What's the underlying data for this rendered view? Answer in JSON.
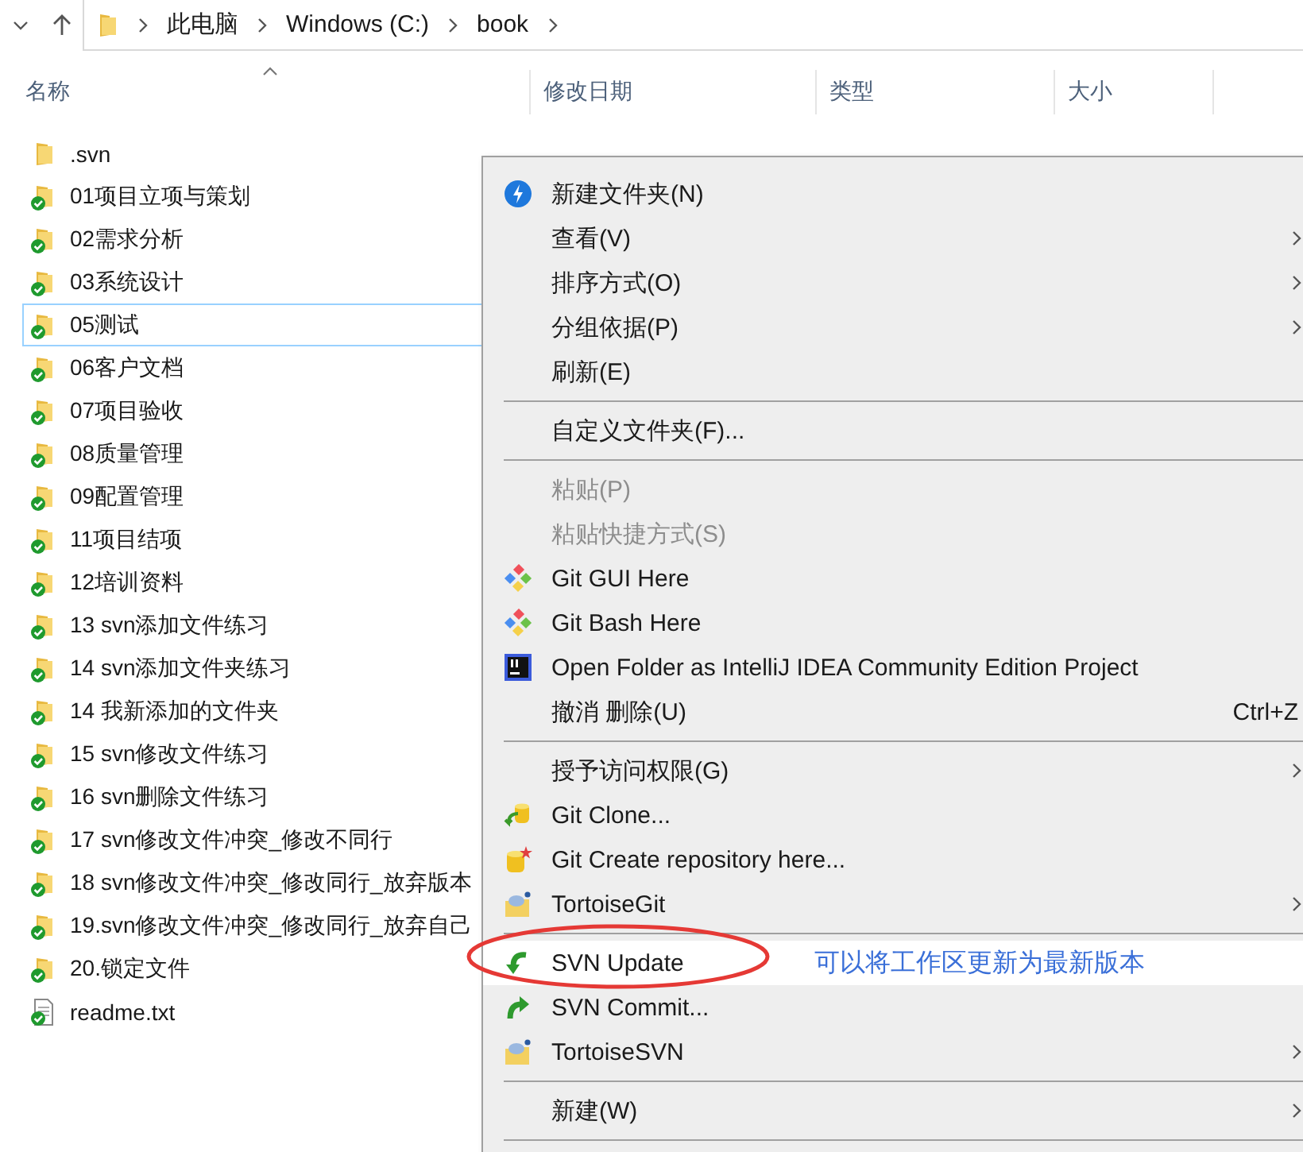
{
  "address_bar": {
    "breadcrumbs": [
      "此电脑",
      "Windows (C:)",
      "book"
    ]
  },
  "columns": [
    {
      "label": "名称",
      "sorted": true
    },
    {
      "label": "修改日期",
      "sorted": false
    },
    {
      "label": "类型",
      "sorted": false
    },
    {
      "label": "大小",
      "sorted": false
    }
  ],
  "files": [
    {
      "name": ".svn",
      "kind": "folder",
      "versioned": false,
      "focused": false
    },
    {
      "name": "01项目立项与策划",
      "kind": "folder",
      "versioned": true,
      "focused": false
    },
    {
      "name": "02需求分析",
      "kind": "folder",
      "versioned": true,
      "focused": false
    },
    {
      "name": "03系统设计",
      "kind": "folder",
      "versioned": true,
      "focused": false
    },
    {
      "name": "05测试",
      "kind": "folder",
      "versioned": true,
      "focused": true
    },
    {
      "name": "06客户文档",
      "kind": "folder",
      "versioned": true,
      "focused": false
    },
    {
      "name": "07项目验收",
      "kind": "folder",
      "versioned": true,
      "focused": false
    },
    {
      "name": "08质量管理",
      "kind": "folder",
      "versioned": true,
      "focused": false
    },
    {
      "name": "09配置管理",
      "kind": "folder",
      "versioned": true,
      "focused": false
    },
    {
      "name": "11项目结项",
      "kind": "folder",
      "versioned": true,
      "focused": false
    },
    {
      "name": "12培训资料",
      "kind": "folder",
      "versioned": true,
      "focused": false
    },
    {
      "name": "13 svn添加文件练习",
      "kind": "folder",
      "versioned": true,
      "focused": false
    },
    {
      "name": "14 svn添加文件夹练习",
      "kind": "folder",
      "versioned": true,
      "focused": false
    },
    {
      "name": "14 我新添加的文件夹",
      "kind": "folder",
      "versioned": true,
      "focused": false
    },
    {
      "name": "15 svn修改文件练习",
      "kind": "folder",
      "versioned": true,
      "focused": false
    },
    {
      "name": "16 svn删除文件练习",
      "kind": "folder",
      "versioned": true,
      "focused": false
    },
    {
      "name": "17 svn修改文件冲突_修改不同行",
      "kind": "folder",
      "versioned": true,
      "focused": false
    },
    {
      "name": "18 svn修改文件冲突_修改同行_放弃版本",
      "kind": "folder",
      "versioned": true,
      "focused": false
    },
    {
      "name": "19.svn修改文件冲突_修改同行_放弃自己",
      "kind": "folder",
      "versioned": true,
      "focused": false
    },
    {
      "name": "20.锁定文件",
      "kind": "folder",
      "versioned": true,
      "focused": false
    },
    {
      "name": "readme.txt",
      "kind": "file",
      "versioned": true,
      "focused": false
    }
  ],
  "context_menu": {
    "items": [
      {
        "kind": "newfolder",
        "label": "新建文件夹(N)",
        "disabled": false,
        "submenu": false,
        "selected": false
      },
      {
        "kind": "plain",
        "label": "查看(V)",
        "disabled": false,
        "submenu": true,
        "selected": false
      },
      {
        "kind": "plain",
        "label": "排序方式(O)",
        "disabled": false,
        "submenu": true,
        "selected": false
      },
      {
        "kind": "plain",
        "label": "分组依据(P)",
        "disabled": false,
        "submenu": true,
        "selected": false
      },
      {
        "kind": "plain",
        "label": "刷新(E)",
        "disabled": false,
        "submenu": false,
        "selected": false
      },
      {
        "kind": "separator"
      },
      {
        "kind": "plain",
        "label": "自定义文件夹(F)...",
        "disabled": false,
        "submenu": false,
        "selected": false
      },
      {
        "kind": "separator"
      },
      {
        "kind": "plain",
        "label": "粘贴(P)",
        "disabled": true,
        "submenu": false,
        "selected": false
      },
      {
        "kind": "plain",
        "label": "粘贴快捷方式(S)",
        "disabled": true,
        "submenu": false,
        "selected": false
      },
      {
        "kind": "git",
        "label": "Git GUI Here",
        "disabled": false,
        "submenu": false,
        "selected": false
      },
      {
        "kind": "git",
        "label": "Git Bash Here",
        "disabled": false,
        "submenu": false,
        "selected": false
      },
      {
        "kind": "intellij",
        "label": "Open Folder as IntelliJ IDEA Community Edition Project",
        "disabled": false,
        "submenu": false,
        "selected": false
      },
      {
        "kind": "plain",
        "label": "撤消 删除(U)",
        "shortcut": "Ctrl+Z",
        "disabled": false,
        "submenu": false,
        "selected": false
      },
      {
        "kind": "separator"
      },
      {
        "kind": "plain",
        "label": "授予访问权限(G)",
        "disabled": false,
        "submenu": true,
        "selected": false
      },
      {
        "kind": "clone",
        "label": "Git Clone...",
        "disabled": false,
        "submenu": false,
        "selected": false
      },
      {
        "kind": "create",
        "label": "Git Create repository here...",
        "disabled": false,
        "submenu": false,
        "selected": false
      },
      {
        "kind": "tortoise",
        "label": "TortoiseGit",
        "disabled": false,
        "submenu": true,
        "selected": false
      },
      {
        "kind": "separator"
      },
      {
        "kind": "update",
        "label": "SVN Update",
        "disabled": false,
        "submenu": false,
        "selected": true,
        "annotation": "可以将工作区更新为最新版本"
      },
      {
        "kind": "commit",
        "label": "SVN Commit...",
        "disabled": false,
        "submenu": false,
        "selected": false
      },
      {
        "kind": "tortoise",
        "label": "TortoiseSVN",
        "disabled": false,
        "submenu": true,
        "selected": false
      },
      {
        "kind": "separator"
      },
      {
        "kind": "plain",
        "label": "新建(W)",
        "disabled": false,
        "submenu": true,
        "selected": false
      },
      {
        "kind": "separator"
      }
    ]
  }
}
